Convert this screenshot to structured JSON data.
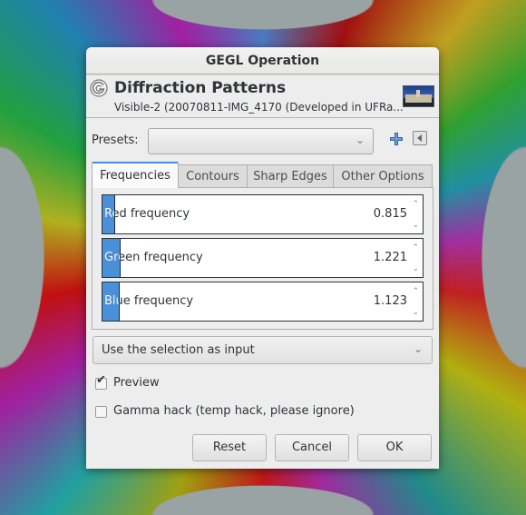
{
  "window": {
    "title": "GEGL Operation"
  },
  "header": {
    "icon": "gegl-spiral-icon",
    "title": "Diffraction Patterns",
    "subtitle": "Visible-2 (20070811-IMG_4170 (Developed in UFRa...",
    "thumbnail": "image-thumbnail"
  },
  "presets": {
    "label": "Presets:",
    "value": "",
    "add_icon": "plus-icon",
    "menu_icon": "left-arrow-menu-icon"
  },
  "tabs": [
    {
      "label": "Frequencies",
      "active": true
    },
    {
      "label": "Contours",
      "active": false
    },
    {
      "label": "Sharp Edges",
      "active": false
    },
    {
      "label": "Other Options",
      "active": false
    }
  ],
  "sliders": [
    {
      "label": "Red frequency",
      "value": "0.815",
      "fill_fraction": 0.037
    },
    {
      "label": "Green frequency",
      "value": "1.221",
      "fill_fraction": 0.055
    },
    {
      "label": "Blue frequency",
      "value": "1.123",
      "fill_fraction": 0.051
    }
  ],
  "input_source": {
    "value": "Use the selection as input"
  },
  "preview": {
    "label": "Preview",
    "checked": true
  },
  "gamma_hack": {
    "label": "Gamma hack (temp hack, please ignore)",
    "checked": false
  },
  "buttons": {
    "reset": "Reset",
    "cancel": "Cancel",
    "ok": "OK"
  },
  "colors": {
    "accent": "#4a90d9",
    "plus": "#3465a4"
  }
}
